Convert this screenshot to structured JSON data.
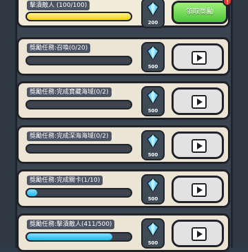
{
  "top_row": {
    "title": "擊潰敵人 (100/100)",
    "reward": "200",
    "claim_label": "領取獎勵",
    "badge": "!",
    "progress": 1.0
  },
  "rows": [
    {
      "title": "獎勵任務:召喚(0/20)",
      "reward": "500",
      "progress": 0.0
    },
    {
      "title": "獎勵任務:完成寶藏海域(0/2)",
      "reward": "500",
      "progress": 0.0
    },
    {
      "title": "獎勵任務:完成深海海域(0/2)",
      "reward": "500",
      "progress": 0.0
    },
    {
      "title": "獎勵任務:完成關卡(1/10)",
      "reward": "500",
      "progress": 0.1
    },
    {
      "title": "獎勵任務:擊潰敵人(411/500)",
      "reward": "500",
      "progress": 0.822
    }
  ]
}
